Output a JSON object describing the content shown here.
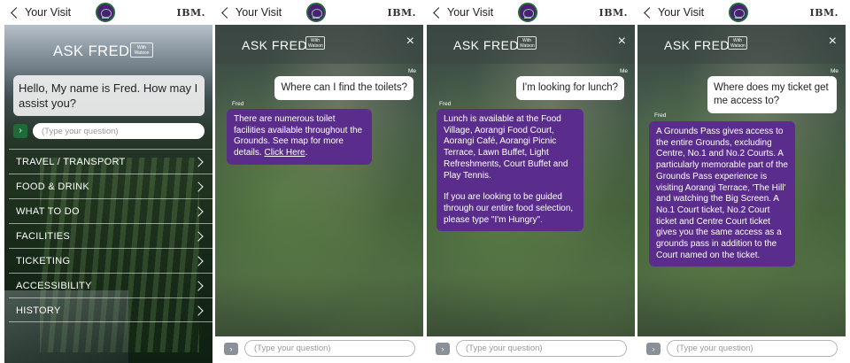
{
  "status": {
    "back_label": "Your Visit",
    "ibm_label": "IBM."
  },
  "colors": {
    "accent_purple": "#5a2d8c",
    "accent_green": "#1f6b38",
    "send_grey": "#8a9097"
  },
  "icons": [
    "chevron-left-icon",
    "wimbledon-logo-icon",
    "close-icon",
    "chevron-right-icon",
    "send-icon"
  ],
  "home": {
    "title": "ASK FRED",
    "watson_badge": "With Watson",
    "greeting": "Hello, My name is Fred. How may I assist you?",
    "send_glyph": "›",
    "input_placeholder": "(Type your question)",
    "menu": [
      {
        "label": "TRAVEL / TRANSPORT"
      },
      {
        "label": "FOOD & DRINK"
      },
      {
        "label": "WHAT TO DO"
      },
      {
        "label": "FACILITIES"
      },
      {
        "label": "TICKETING"
      },
      {
        "label": "ACCESSIBILITY"
      },
      {
        "label": "HISTORY"
      }
    ]
  },
  "chat": {
    "title": "ASK FRED",
    "watson_badge": "With Watson",
    "close_glyph": "×",
    "me_label": "Me",
    "fred_label": "Fred",
    "send_glyph": "›",
    "input_placeholder": "(Type your question)"
  },
  "conversations": [
    {
      "question": "Where can I find the toilets?",
      "answer": "There are numerous toilet facilities available throughout the Grounds. See map for more details.",
      "link_text": "Click Here"
    },
    {
      "question": "I'm looking for lunch?",
      "answer_p1": "Lunch is available at the Food Village, Aorangi Food Court, Aorangi Café, Aorangi Picnic Terrace, Lawn Buffet, Light Refreshments, Court Buffet and Play Tennis.",
      "answer_p2": "If you are looking to be guided through our entire food selection, please type \"I'm Hungry\"."
    },
    {
      "question": "Where does my ticket get me access to?",
      "answer": "A Grounds Pass gives access to the entire Grounds, excluding Centre, No.1 and No.2 Courts. A particularly memorable part of the Grounds Pass experience is visiting Aorangi Terrace, 'The Hill' and watching the Big Screen. A No.1 Court ticket, No.2 Court ticket and Centre Court ticket gives you the same access as a grounds pass in addition to the Court named on the ticket."
    }
  ]
}
